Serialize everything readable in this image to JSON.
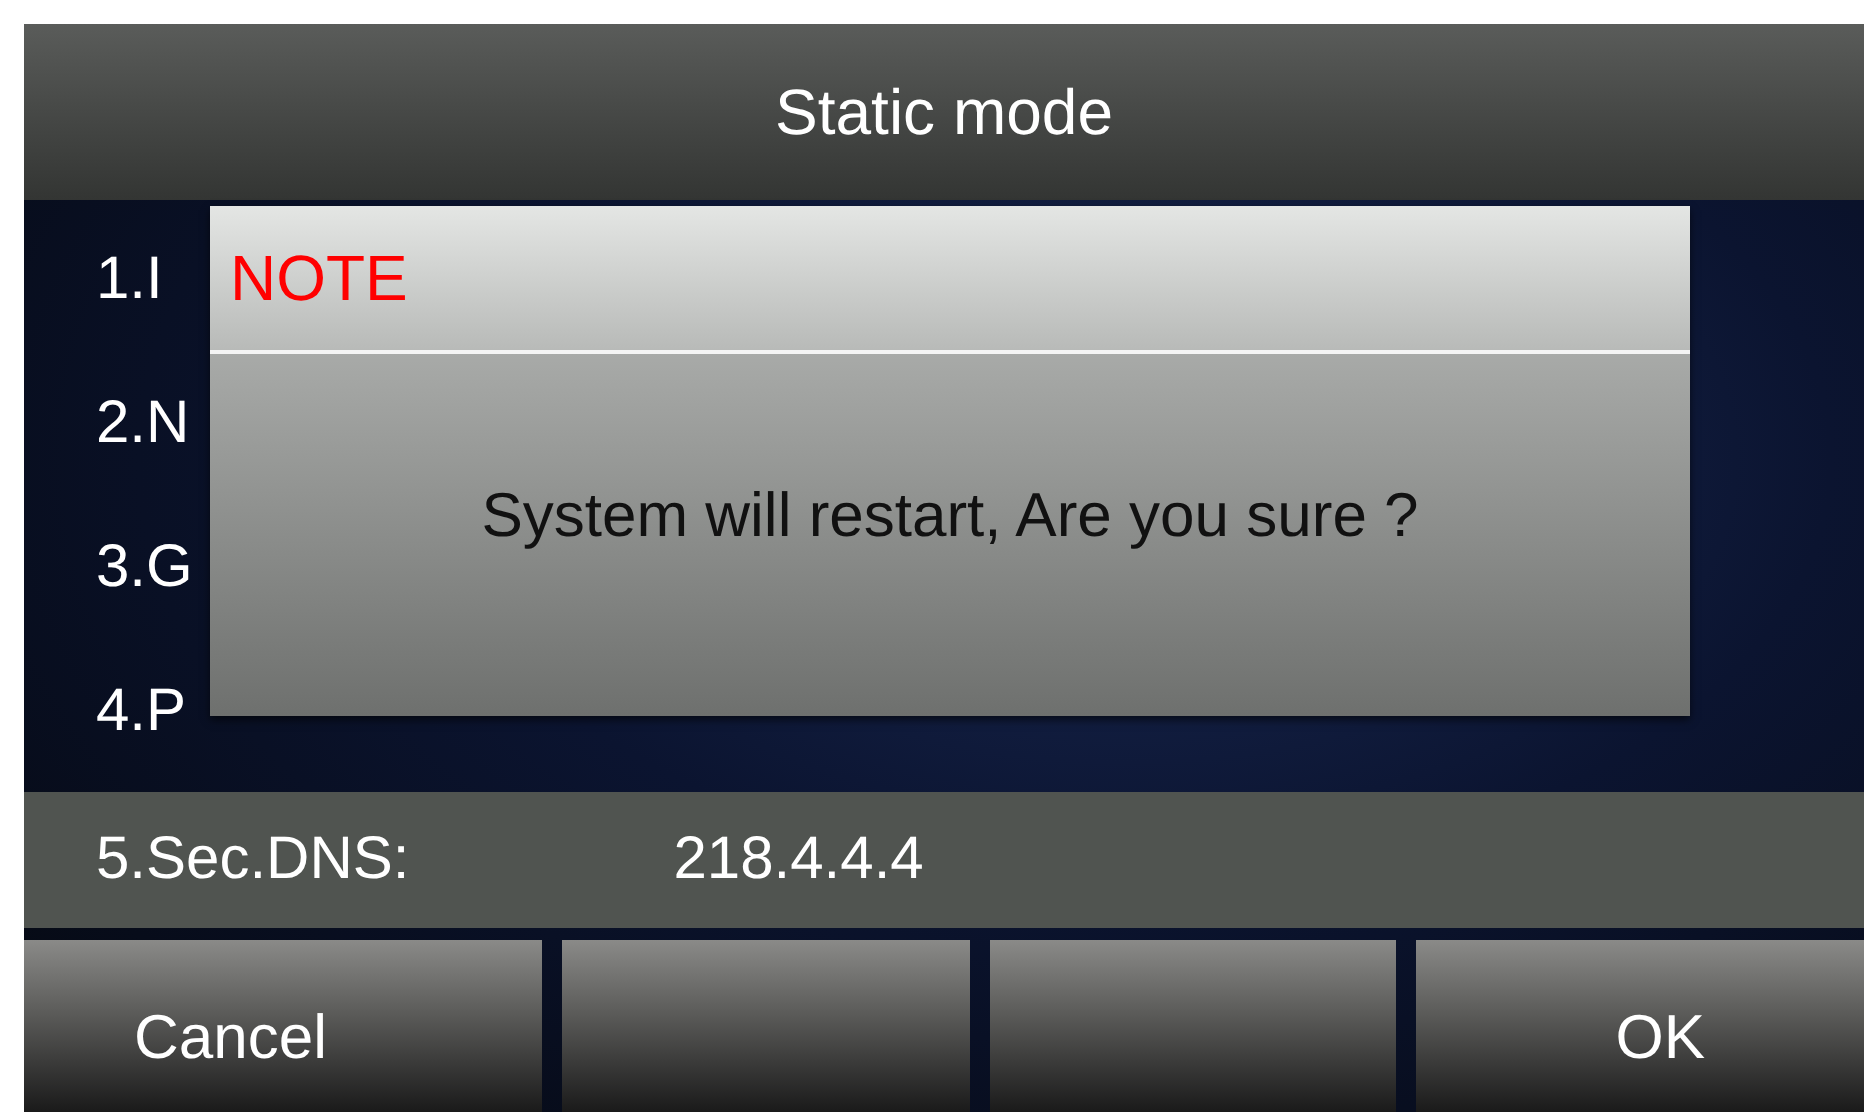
{
  "title": "Static mode",
  "rows": [
    {
      "label": "1.I",
      "selected": false
    },
    {
      "label": "2.N",
      "selected": false
    },
    {
      "label": "3.G",
      "selected": false
    },
    {
      "label": "4.P",
      "selected": false
    },
    {
      "label": "5.Sec.DNS:",
      "value": "218.4.4.4",
      "selected": true
    }
  ],
  "dialog": {
    "title": "NOTE",
    "message": "System will restart, Are you sure ?"
  },
  "softkeys": {
    "left": "Cancel",
    "right": "OK"
  }
}
